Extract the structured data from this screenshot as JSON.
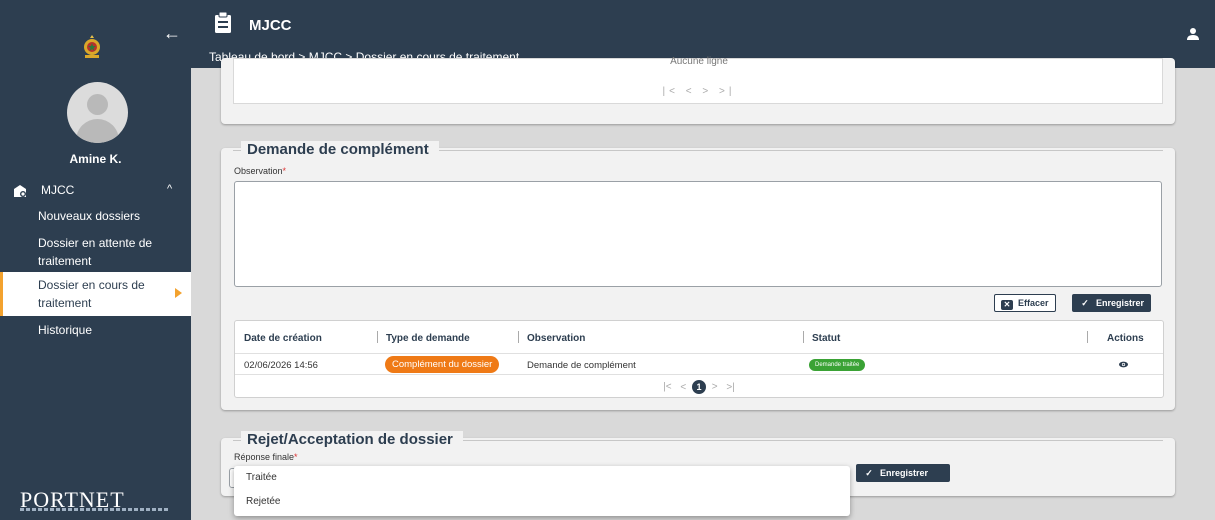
{
  "sidebar": {
    "user_name": "Amine K.",
    "group_label": "MJCC",
    "items": [
      {
        "label": "Nouveaux dossiers"
      },
      {
        "label": "Dossier en attente de traitement"
      },
      {
        "label": "Dossier en cours de traitement"
      },
      {
        "label": "Historique"
      }
    ],
    "footer_logo": "PORTNET",
    "icons": {
      "back": "arrow-left-icon",
      "group": "folder-gear-icon",
      "chevron": "chevron-up-icon"
    }
  },
  "topbar": {
    "title": "MJCC",
    "breadcrumb": "Tableau de bord > MJCC > Dossier en cours de traitement"
  },
  "top_card": {
    "empty_text": "Aucune ligne",
    "pager": "|< < > >|"
  },
  "complement": {
    "title": "Demande de complément",
    "observation_label": "Observation",
    "required_mark": "*",
    "clear_label": "Effacer",
    "save_label": "Enregistrer",
    "table": {
      "headers": [
        "Date de création",
        "Type de demande",
        "Observation",
        "Statut",
        "Actions"
      ],
      "rows": [
        {
          "date": "02/06/2026 14:56",
          "type": "Complément du dossier",
          "observation": "Demande de complément",
          "status": "Demande traitée"
        }
      ],
      "pager_first": "|<",
      "pager_prev": "<",
      "pager_page": "1",
      "pager_next": ">",
      "pager_last": ">|"
    }
  },
  "decision": {
    "title": "Rejet/Acceptation de dossier",
    "final_label": "Réponse finale",
    "required_mark": "*",
    "save_label": "Enregistrer",
    "options": [
      "Traitée",
      "Rejetée"
    ]
  },
  "colors": {
    "navy": "#2d3e50",
    "accent": "#f3a22e",
    "chip_orange": "#ef7a16",
    "chip_green": "#3aa235"
  }
}
